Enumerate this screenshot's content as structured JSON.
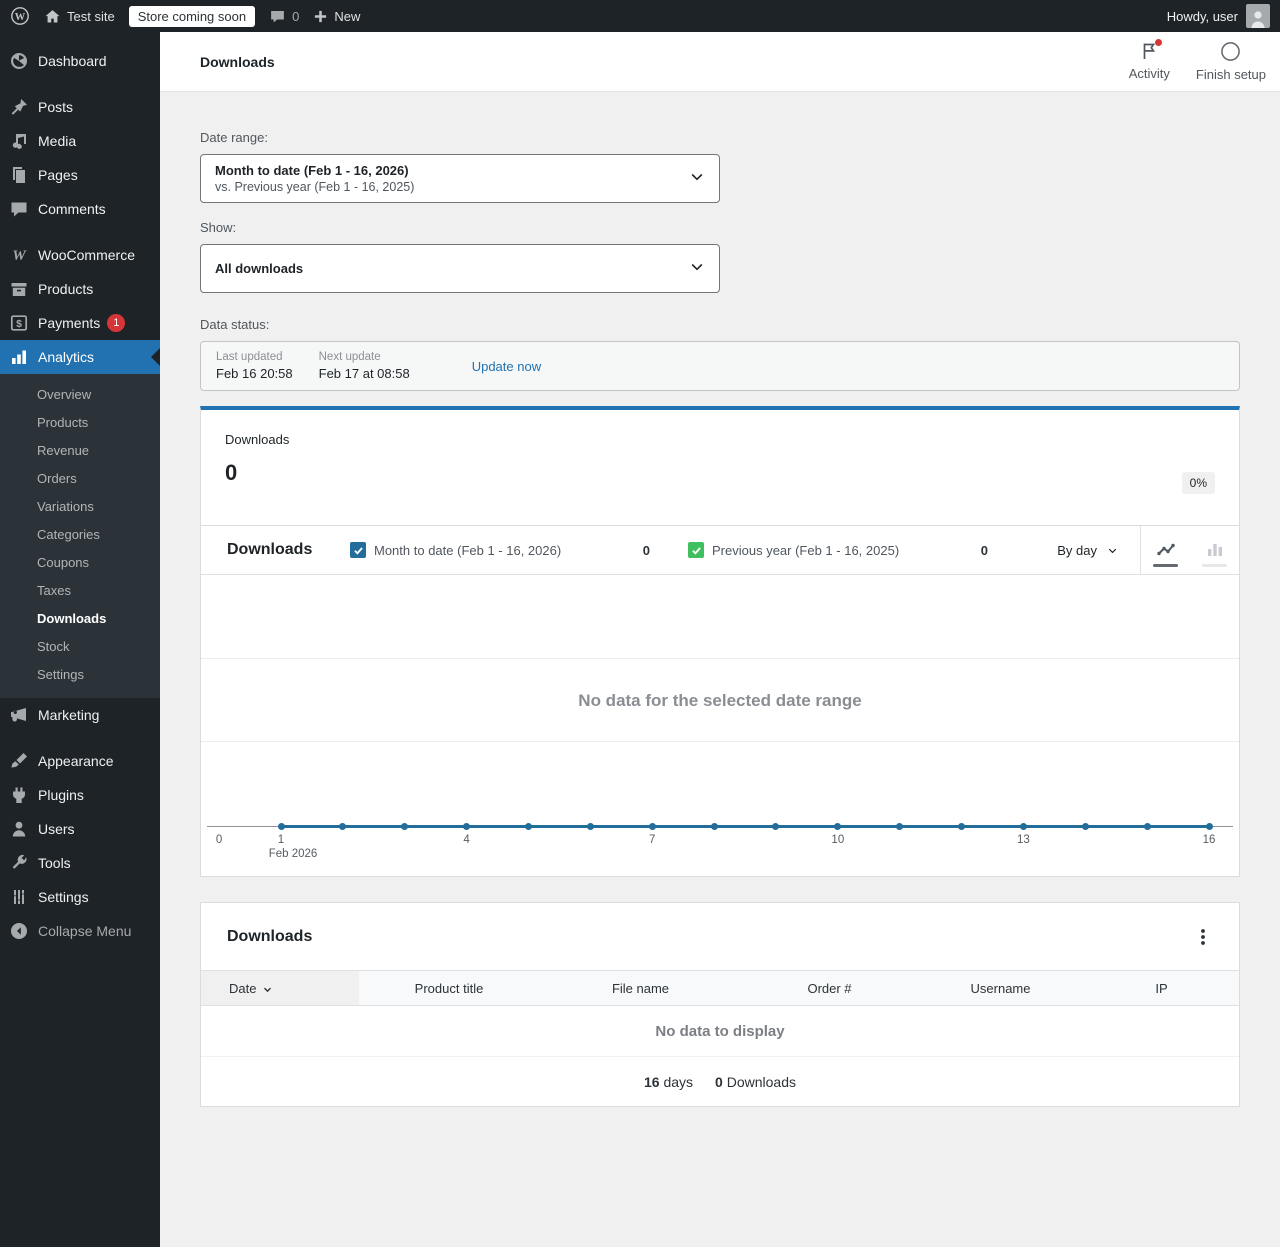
{
  "admin_bar": {
    "site_name": "Test site",
    "coming_soon_badge": "Store coming soon",
    "comments_count": "0",
    "new_label": "New",
    "howdy": "Howdy, user"
  },
  "sidebar": {
    "items": [
      {
        "label": "Dashboard",
        "icon": "dashboard"
      },
      {
        "label": "Posts",
        "icon": "posts",
        "sep_before": true
      },
      {
        "label": "Media",
        "icon": "media"
      },
      {
        "label": "Pages",
        "icon": "pages"
      },
      {
        "label": "Comments",
        "icon": "comments"
      },
      {
        "label": "WooCommerce",
        "icon": "woocommerce",
        "sep_before": true
      },
      {
        "label": "Products",
        "icon": "products"
      },
      {
        "label": "Payments",
        "icon": "payments",
        "badge": "1"
      },
      {
        "label": "Analytics",
        "icon": "analytics",
        "active": true,
        "submenu": [
          {
            "label": "Overview"
          },
          {
            "label": "Products"
          },
          {
            "label": "Revenue"
          },
          {
            "label": "Orders"
          },
          {
            "label": "Variations"
          },
          {
            "label": "Categories"
          },
          {
            "label": "Coupons"
          },
          {
            "label": "Taxes"
          },
          {
            "label": "Downloads",
            "active": true
          },
          {
            "label": "Stock"
          },
          {
            "label": "Settings"
          }
        ]
      },
      {
        "label": "Marketing",
        "icon": "marketing"
      },
      {
        "label": "Appearance",
        "icon": "appearance",
        "sep_before": true
      },
      {
        "label": "Plugins",
        "icon": "plugins"
      },
      {
        "label": "Users",
        "icon": "users"
      },
      {
        "label": "Tools",
        "icon": "tools"
      },
      {
        "label": "Settings",
        "icon": "settings"
      },
      {
        "label": "Collapse Menu",
        "icon": "collapse",
        "muted": true
      }
    ]
  },
  "header": {
    "title": "Downloads",
    "activity_label": "Activity",
    "finish_setup_label": "Finish setup"
  },
  "filters": {
    "date_range_label": "Date range:",
    "date_range_primary": "Month to date (Feb 1 - 16, 2026)",
    "date_range_secondary": "vs. Previous year (Feb 1 - 16, 2025)",
    "show_label": "Show:",
    "show_value": "All downloads"
  },
  "data_status": {
    "label": "Data status:",
    "last_updated_label": "Last updated",
    "last_updated_value": "Feb 16 20:58",
    "next_update_label": "Next update",
    "next_update_value": "Feb 17 at 08:58",
    "update_now_label": "Update now"
  },
  "summary": {
    "label": "Downloads",
    "value": "0",
    "delta": "0%"
  },
  "chart": {
    "title": "Downloads",
    "legend": [
      {
        "label": "Month to date (Feb 1 - 16, 2026)",
        "value": "0",
        "color": "#236d9b"
      },
      {
        "label": "Previous year (Feb 1 - 16, 2025)",
        "value": "0",
        "color": "#3fbf60"
      }
    ],
    "interval": "By day",
    "empty_message": "No data for the selected date range"
  },
  "chart_data": {
    "type": "line",
    "title": "Downloads",
    "x": [
      1,
      2,
      3,
      4,
      5,
      6,
      7,
      8,
      9,
      10,
      11,
      12,
      13,
      14,
      15,
      16
    ],
    "series": [
      {
        "name": "Month to date (Feb 1 - 16, 2026)",
        "values": [
          0,
          0,
          0,
          0,
          0,
          0,
          0,
          0,
          0,
          0,
          0,
          0,
          0,
          0,
          0,
          0
        ],
        "color": "#236d9b"
      },
      {
        "name": "Previous year (Feb 1 - 16, 2025)",
        "values": [
          0,
          0,
          0,
          0,
          0,
          0,
          0,
          0,
          0,
          0,
          0,
          0,
          0,
          0,
          0,
          0
        ],
        "color": "#3fbf60"
      }
    ],
    "x_ticks": [
      0,
      1,
      4,
      7,
      10,
      13,
      16
    ],
    "month_label": "Feb 2026",
    "month_label_tick": 1,
    "ylim": [
      0,
      1
    ],
    "grid": true,
    "legend_position": "top"
  },
  "table": {
    "title": "Downloads",
    "columns": [
      {
        "label": "Date",
        "sorted": true
      },
      {
        "label": "Product title"
      },
      {
        "label": "File name"
      },
      {
        "label": "Order #"
      },
      {
        "label": "Username"
      },
      {
        "label": "IP"
      }
    ],
    "empty_message": "No data to display",
    "summary": [
      {
        "value": "16",
        "label": "days"
      },
      {
        "value": "0",
        "label": "Downloads"
      }
    ]
  },
  "colors": {
    "accent_blue": "#2271b1",
    "chart_blue": "#236d9b",
    "chart_green": "#3fbf60",
    "badge_red": "#d63638",
    "sidebar_bg": "#1d2327",
    "submenu_bg": "#2c3338"
  }
}
